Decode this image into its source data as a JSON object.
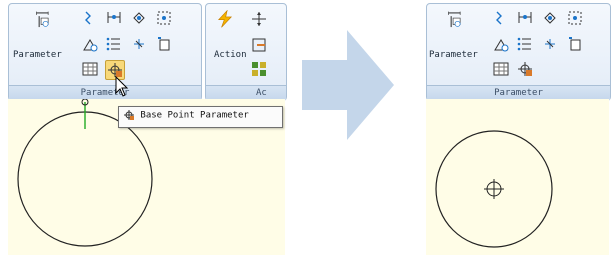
{
  "before": {
    "ribbon": {
      "group_label": "Parameter",
      "parameter_label": "Parameter",
      "action_label": "Action",
      "action_group_label": "Ac"
    },
    "tooltip": {
      "text": "Base Point Parameter"
    }
  },
  "after": {
    "ribbon": {
      "group_label": "Parameter",
      "parameter_label": "Parameter"
    }
  },
  "colors": {
    "ribbon_border": "#a9bfd6",
    "drawing_bg": "#fffde7",
    "arrow": "#c4d6ea",
    "highlight": "#f8d97a",
    "param_line": "#22aa22"
  }
}
